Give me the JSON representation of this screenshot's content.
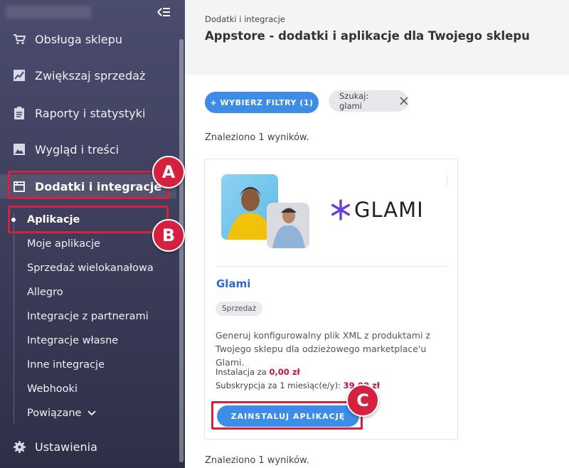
{
  "sidebar": {
    "items": [
      {
        "label": "Obsługa sklepu",
        "icon": "cart-icon"
      },
      {
        "label": "Zwiększaj sprzedaż",
        "icon": "chart-line-icon"
      },
      {
        "label": "Raporty i statystyki",
        "icon": "clipboard-icon"
      },
      {
        "label": "Wygląd i treści",
        "icon": "image-icon"
      },
      {
        "label": "Dodatki i integracje",
        "icon": "window-icon"
      }
    ],
    "subitems": [
      "Aplikacje",
      "Moje aplikacje",
      "Sprzedaż wielokanałowa",
      "Allegro",
      "Integracje z partnerami",
      "Integracje własne",
      "Inne integracje",
      "Webhooki",
      "Powiązane"
    ],
    "settings_label": "Ustawienia"
  },
  "annotations": {
    "a": "A",
    "b": "B",
    "c": "C"
  },
  "header": {
    "breadcrumb": "Dodatki i integracje",
    "title": "Appstore - dodatki i aplikacje dla Twojego sklepu"
  },
  "filters": {
    "filter_button": "+ WYBIERZ FILTRY (1)",
    "search_chip": "Szukaj: glami"
  },
  "results": {
    "count_text": "Znaleziono 1 wyników."
  },
  "app_card": {
    "logo_text": "GLAMI",
    "name": "Glami",
    "tag": "Sprzedaż",
    "description": "Generuj konfigurowalny plik XML z produktami z Twojego sklepu dla odzieżowego marketplace'u Glami.",
    "install_label": "Instalacja za",
    "install_price": "0,00 zł",
    "subscription_label": "Subskrypcja za 1 miesiąc(e/y):",
    "subscription_price": "39,00 zł",
    "install_button": "ZAINSTALUJ APLIKACJĘ"
  },
  "colors": {
    "accent": "#3d8ce8",
    "highlight": "#d4213f",
    "price": "#c8103e",
    "glami_purple": "#6b3fe0"
  }
}
